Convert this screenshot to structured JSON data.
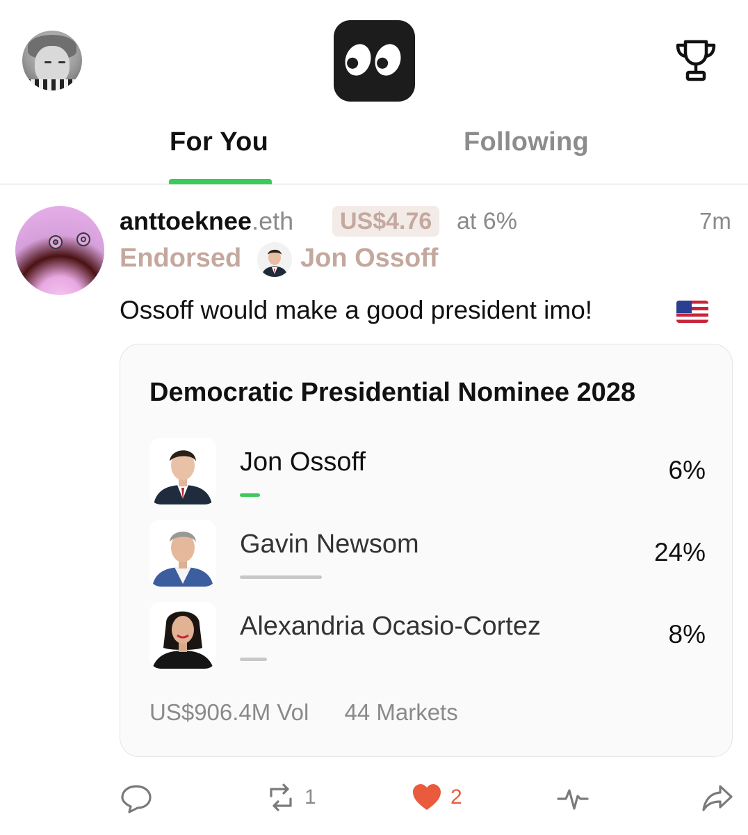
{
  "header": {
    "tabs": [
      {
        "label": "For You",
        "active": true
      },
      {
        "label": "Following",
        "active": false
      }
    ],
    "accent_color": "#3dc95c"
  },
  "post": {
    "handle": "anttoeknee",
    "handle_suffix": ".eth",
    "amount": "US$4.76",
    "at_pct": "at 6%",
    "time": "7m",
    "endorsed_label": "Endorsed",
    "endorsed_name": "Jon Ossoff",
    "text": "Ossoff would make a good president imo!",
    "flag_icon": "us-flag"
  },
  "market": {
    "title": "Democratic Presidential Nominee 2028",
    "outcomes": [
      {
        "name": "Jon Ossoff",
        "pct": "6%",
        "value": 6,
        "bar_color": "#3dc95c"
      },
      {
        "name": "Gavin Newsom",
        "pct": "24%",
        "value": 24,
        "bar_color": "#c8c8c8"
      },
      {
        "name": "Alexandria Ocasio-Cortez",
        "pct": "8%",
        "value": 8,
        "bar_color": "#c8c8c8"
      }
    ],
    "volume": "US$906.4M Vol",
    "markets": "44 Markets"
  },
  "actions": {
    "reposts": "1",
    "likes": "2",
    "like_color": "#ea5a3c"
  }
}
